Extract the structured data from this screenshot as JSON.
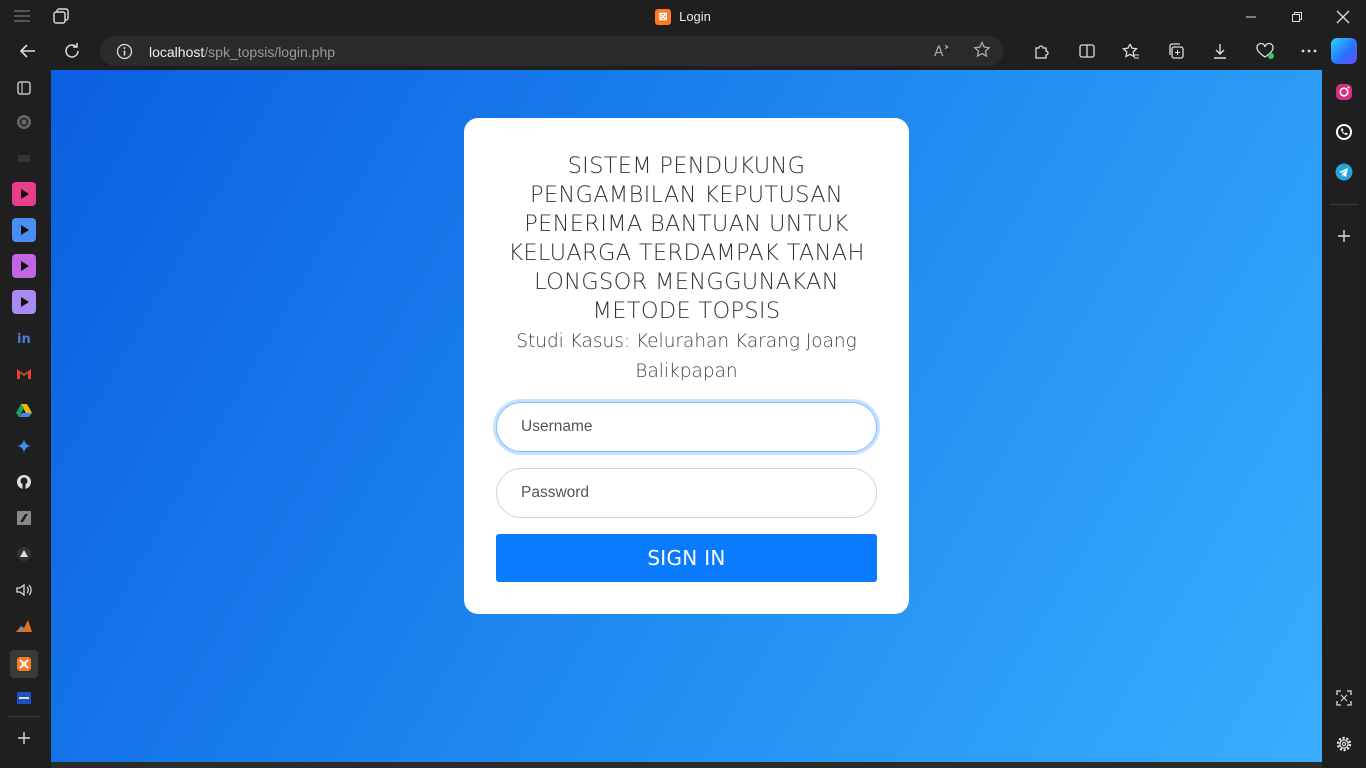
{
  "window": {
    "tab_title": "Login",
    "favicon_glyph": "⊠"
  },
  "addressbar": {
    "url_host": "localhost",
    "url_path": "/spk_topsis/login.php"
  },
  "colors": {
    "viewport_gradient_start": "#0a5fe0",
    "viewport_gradient_end": "#38aefd",
    "button": "#0a7bff",
    "card": "#ffffff"
  },
  "sidebar_icons": [
    "tab-actions-icon",
    "workspaces-icon",
    "mail-icon",
    "media-player-pink-icon",
    "media-player-blue-icon",
    "media-player-purple-icon",
    "media-player-violet-icon",
    "linkedin-icon",
    "gmail-icon",
    "google-drive-icon",
    "gemini-icon",
    "github-icon",
    "app-icon",
    "triangle-app-icon",
    "speaker-icon",
    "matlab-icon",
    "xampp-icon",
    "toolbox-icon",
    "add-icon"
  ],
  "right_sidebar_icons": [
    "instagram-icon",
    "whatsapp-icon",
    "telegram-icon",
    "add-icon",
    "screenshot-icon",
    "settings-icon"
  ],
  "login": {
    "title": "SISTEM PENDUKUNG PENGAMBILAN KEPUTUSAN PENERIMA BANTUAN UNTUK KELUARGA TERDAMPAK TANAH LONGSOR MENGGUNAKAN METODE TOPSIS",
    "subtitle": "Studi Kasus: Kelurahan Karang Joang Balikpapan",
    "username_placeholder": "Username",
    "password_placeholder": "Password",
    "button_label": "SIGN IN"
  }
}
